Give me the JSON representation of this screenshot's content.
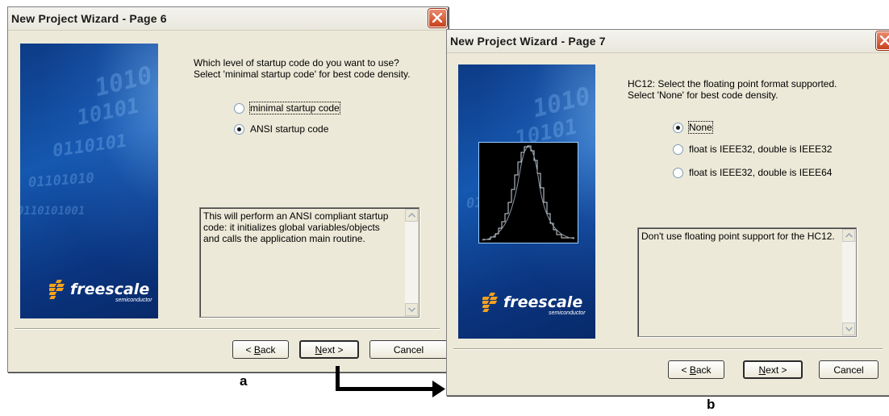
{
  "dialog_a": {
    "title": "New Project Wizard - Page  6",
    "prompt_line1": "Which level of startup code do you want to use?",
    "prompt_line2": "Select 'minimal startup code' for best code density.",
    "options": [
      {
        "label": "minimal startup code",
        "selected": false
      },
      {
        "label": "ANSI startup code",
        "selected": true
      }
    ],
    "description_lines": [
      "This will perform an ANSI compliant startup",
      "code: it initializes global variables/objects",
      "and calls the application main routine."
    ],
    "logo_text": "freescale",
    "logo_subtext": "semiconductor",
    "back_label_mnemonic": "B",
    "back_label_rest": "ack",
    "next_label_mnemonic": "N",
    "next_label_rest": "ext >",
    "cancel_label": "Cancel",
    "caption": "a"
  },
  "dialog_b": {
    "title": "New Project Wizard - Page  7",
    "prompt_line1": "HC12: Select the floating point format supported.",
    "prompt_line2": "Select 'None' for best code density.",
    "options": [
      {
        "label": "None",
        "selected": true
      },
      {
        "label": "float is IEEE32, double is IEEE32",
        "selected": false
      },
      {
        "label": "float is IEEE32, double is IEEE64",
        "selected": false
      }
    ],
    "description_lines": [
      "Don't use floating point support for the HC12."
    ],
    "logo_text": "freescale",
    "logo_subtext": "semiconductor",
    "back_label_mnemonic": "B",
    "back_label_rest": "ack",
    "next_label_mnemonic": "N",
    "next_label_rest": "ext >",
    "cancel_label": "Cancel",
    "caption": "b"
  },
  "colors": {
    "dialog_bg": "#ece9d8",
    "banner_blue": "#1558b0",
    "close_red": "#c8421d"
  },
  "icons": {
    "close": "close-icon",
    "logo": "freescale-logo-icon",
    "histogram": "histogram-graphic-icon",
    "arrow": "flow-arrow-icon"
  }
}
